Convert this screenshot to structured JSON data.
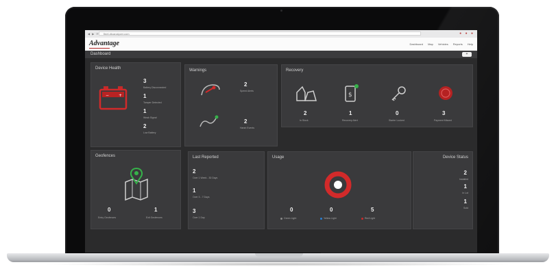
{
  "browser": {
    "url": "fleet.dtcanalyzer.com"
  },
  "app": {
    "logo": "Advantage",
    "nav": [
      "Dashboard",
      "Map",
      "Vehicles",
      "Reports",
      "Help"
    ],
    "subbar_title": "Dashboard",
    "subbar_button": "+"
  },
  "device_health": {
    "title": "Device Health",
    "items": [
      {
        "count": "3",
        "label": "Battery Disconnected"
      },
      {
        "count": "1",
        "label": "Tamper Detected"
      },
      {
        "count": "1",
        "label": "Weak Signal"
      },
      {
        "count": "2",
        "label": "Low Battery"
      }
    ]
  },
  "warnings": {
    "title": "Warnings",
    "items": [
      {
        "count": "2",
        "label": "Speed Alerts"
      },
      {
        "count": "2",
        "label": "Harsh Events"
      }
    ]
  },
  "recovery": {
    "title": "Recovery",
    "items": [
      {
        "count": "2",
        "label": "In Stock"
      },
      {
        "count": "1",
        "label": "Recovery Alert"
      },
      {
        "count": "0",
        "label": "Starter Locked"
      },
      {
        "count": "3",
        "label": "Payment Missed"
      }
    ]
  },
  "geofences": {
    "title": "Geofences",
    "items": [
      {
        "count": "0",
        "label": "Entry Geofences"
      },
      {
        "count": "1",
        "label": "Exit Geofences"
      }
    ]
  },
  "last_reported": {
    "title": "Last Reported",
    "items": [
      {
        "count": "2",
        "label": "Over 1 Week - 30 Days"
      },
      {
        "count": "1",
        "label": "Over 3 - 7 Days"
      },
      {
        "count": "3",
        "label": "Over 1 Day"
      }
    ]
  },
  "usage": {
    "title": "Usage",
    "items": [
      {
        "count": "0",
        "label": "Green Light",
        "color": "#8a8a8a"
      },
      {
        "count": "0",
        "label": "Yellow Light",
        "color": "#2a7fd4"
      },
      {
        "count": "5",
        "label": "Red Light",
        "color": "#d02a2a"
      }
    ]
  },
  "device_status": {
    "title": "Device Status",
    "items": [
      {
        "count": "2",
        "label": "Installed"
      },
      {
        "count": "1",
        "label": "In Lot"
      },
      {
        "count": "1",
        "label": "Sold"
      }
    ]
  },
  "colors": {
    "accent": "#d22a2a",
    "geofence": "#36b24a",
    "panel": "#3a3a3c",
    "screen": "#2b2b2c"
  }
}
